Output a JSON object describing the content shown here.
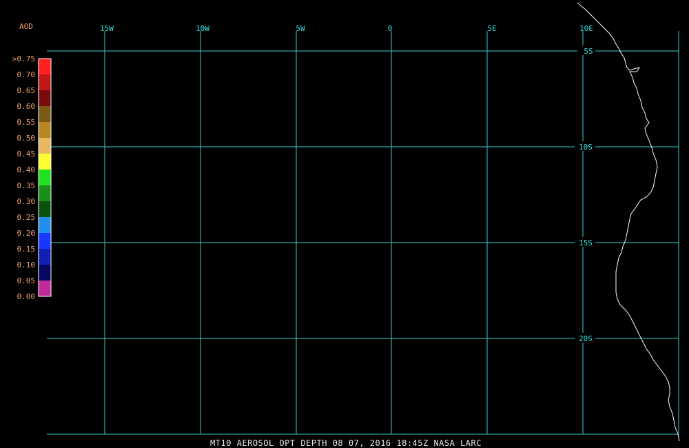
{
  "map": {
    "lon_labels": [
      "15W",
      "10W",
      "5W",
      "0",
      "5E",
      "10E"
    ],
    "lat_labels": [
      "5S",
      "10S",
      "15S",
      "20S"
    ]
  },
  "legend": {
    "title": "AOD",
    "labels": [
      ">0.75",
      "0.70",
      "0.65",
      "0.60",
      "0.55",
      "0.50",
      "0.45",
      "0.40",
      "0.35",
      "0.30",
      "0.25",
      "0.20",
      "0.15",
      "0.10",
      "0.05",
      "0.00"
    ],
    "colors": [
      "#ff2020",
      "#c01818",
      "#7a0c0c",
      "#7a5a14",
      "#b88820",
      "#e8b860",
      "#ffff30",
      "#20e020",
      "#18901a",
      "#0a5010",
      "#2090f0",
      "#1838ff",
      "#1020b0",
      "#080860",
      "#c02a9a"
    ]
  },
  "footer": {
    "text": "MT10  AEROSOL OPT DEPTH   08 07, 2016 18:45Z   NASA LARC"
  },
  "colors": {
    "grid": "#2fd0d0",
    "coastline": "#ffffff",
    "background": "#000000"
  }
}
